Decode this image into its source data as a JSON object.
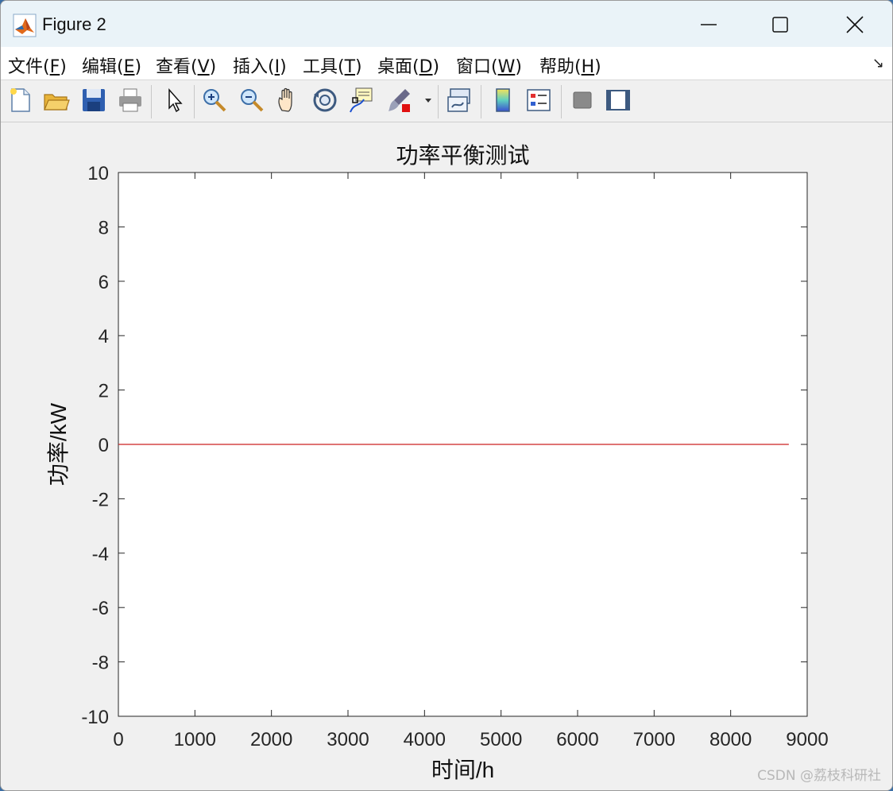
{
  "window": {
    "title": "Figure 2"
  },
  "menu": {
    "items": [
      {
        "text": "文件(",
        "acc": "F",
        "tail": ")"
      },
      {
        "text": "编辑(",
        "acc": "E",
        "tail": ")"
      },
      {
        "text": "查看(",
        "acc": "V",
        "tail": ")"
      },
      {
        "text": "插入(",
        "acc": "I",
        "tail": ")"
      },
      {
        "text": "工具(",
        "acc": "T",
        "tail": ")"
      },
      {
        "text": "桌面(",
        "acc": "D",
        "tail": ")"
      },
      {
        "text": "窗口(",
        "acc": "W",
        "tail": ")"
      },
      {
        "text": "帮助(",
        "acc": "H",
        "tail": ")"
      }
    ]
  },
  "toolbar": {
    "tools": [
      "new-figure",
      "open-file",
      "save-figure",
      "print-figure",
      "edit-plot",
      "zoom-in",
      "zoom-out",
      "pan",
      "rotate-3d",
      "data-cursor",
      "brush",
      "link-plot",
      "colorbar",
      "legend",
      "hide-plot-tools",
      "show-plot-tools"
    ]
  },
  "chart_data": {
    "type": "line",
    "title": "功率平衡测试",
    "xlabel": "时间/h",
    "ylabel": "功率/kW",
    "xlim": [
      0,
      9000
    ],
    "ylim": [
      -10,
      10
    ],
    "xticks": [
      "0",
      "1000",
      "2000",
      "3000",
      "4000",
      "5000",
      "6000",
      "7000",
      "8000",
      "9000"
    ],
    "yticks": [
      "10",
      "8",
      "6",
      "4",
      "2",
      "0",
      "-2",
      "-4",
      "-6",
      "-8",
      "-10"
    ],
    "series": [
      {
        "x": [
          0,
          8760
        ],
        "values": [
          0,
          0
        ],
        "color": "#cc2222"
      }
    ],
    "grid": false
  },
  "watermark": "CSDN @荔枝科研社"
}
